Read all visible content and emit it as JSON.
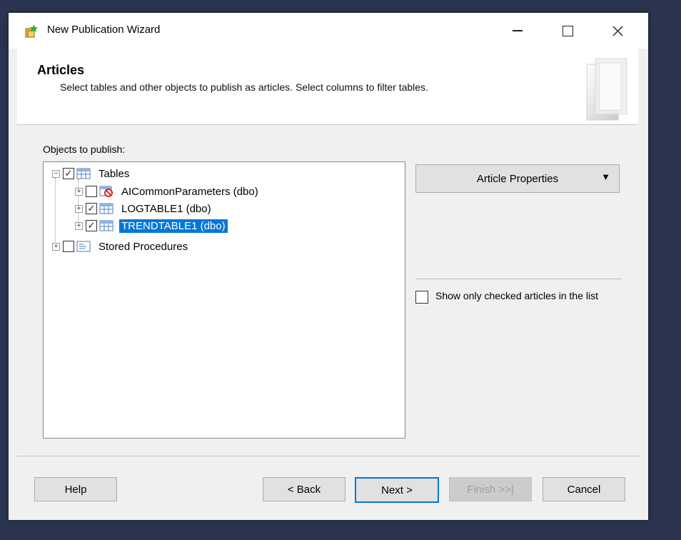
{
  "window": {
    "title": "New Publication Wizard",
    "icon": "wizard-app-icon"
  },
  "header": {
    "title": "Articles",
    "description": "Select tables and other objects to publish as articles. Select columns to filter tables."
  },
  "objects_label": "Objects to publish:",
  "tree": [
    {
      "label": "Tables",
      "checked": true,
      "expander": "minus",
      "icon": "table-icon",
      "selected": false
    },
    {
      "label": "AICommonParameters (dbo)",
      "checked": false,
      "expander": "plus",
      "icon": "table-blocked-icon",
      "selected": false
    },
    {
      "label": "LOGTABLE1 (dbo)",
      "checked": true,
      "expander": "plus",
      "icon": "table-icon",
      "selected": false
    },
    {
      "label": "TRENDTABLE1 (dbo)",
      "checked": true,
      "expander": "plus",
      "icon": "table-icon",
      "selected": true
    },
    {
      "label": "Stored Procedures",
      "checked": false,
      "expander": "plus",
      "icon": "stored-procedure-icon",
      "selected": false
    }
  ],
  "article_properties": {
    "label": "Article Properties",
    "arrow": "▼"
  },
  "show_only": {
    "label": "Show only checked articles in the list",
    "checked": false
  },
  "buttons": {
    "help": "Help",
    "back": "< Back",
    "next": "Next >",
    "finish": "Finish >>|",
    "cancel": "Cancel"
  },
  "colors": {
    "selection": "#0078d7",
    "accent": "#0078d7"
  }
}
